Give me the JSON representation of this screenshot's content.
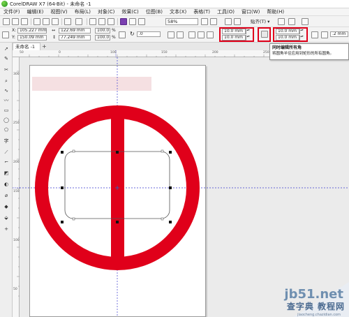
{
  "window": {
    "title": "CorelDRAW X7 (64-Bit) - 未命名 -1"
  },
  "menu": [
    "文件(F)",
    "编辑(E)",
    "视图(V)",
    "布局(L)",
    "对象(C)",
    "效果(C)",
    "位图(B)",
    "文本(X)",
    "表格(T)",
    "工具(O)",
    "窗口(W)",
    "帮助(H)"
  ],
  "toolbar": {
    "zoom": "58%",
    "snap_label": "贴齐(T)"
  },
  "properties": {
    "x_label": "X:",
    "x_value": "105.227 mm",
    "y_label": "Y:",
    "y_value": "150.09 mm",
    "width_value": "122.69 mm",
    "height_value": "77.249 mm",
    "scale_w": "100.0",
    "scale_h": "100.0",
    "percent": "%",
    "rotation": ".0",
    "corner_tl": "10.0 mm",
    "corner_bl": "10.0 mm",
    "corner_tr": "10.0 mm",
    "corner_br": "10.0 mm",
    "outline": ".2 mm"
  },
  "tooltip": {
    "title": "同时编辑所有角",
    "description": "将圆角半径应用到矩形的所有圆角。"
  },
  "tabs": {
    "document": "未命名 -1",
    "add": "+"
  },
  "ruler": {
    "top_ticks": [
      "50",
      "0",
      "100",
      "150",
      "200",
      "250",
      "300"
    ],
    "left_ticks": [
      "300",
      "250",
      "200",
      "150",
      "100",
      "50"
    ]
  },
  "colors": {
    "accent_red": "#e0001a",
    "highlight_box": "#e0001a",
    "guide_blue": "#3a3ad0"
  },
  "watermark": {
    "site": "jb51.net",
    "chinese": "查字典 教程网",
    "url": "jiaocheng.chazidian.com"
  }
}
